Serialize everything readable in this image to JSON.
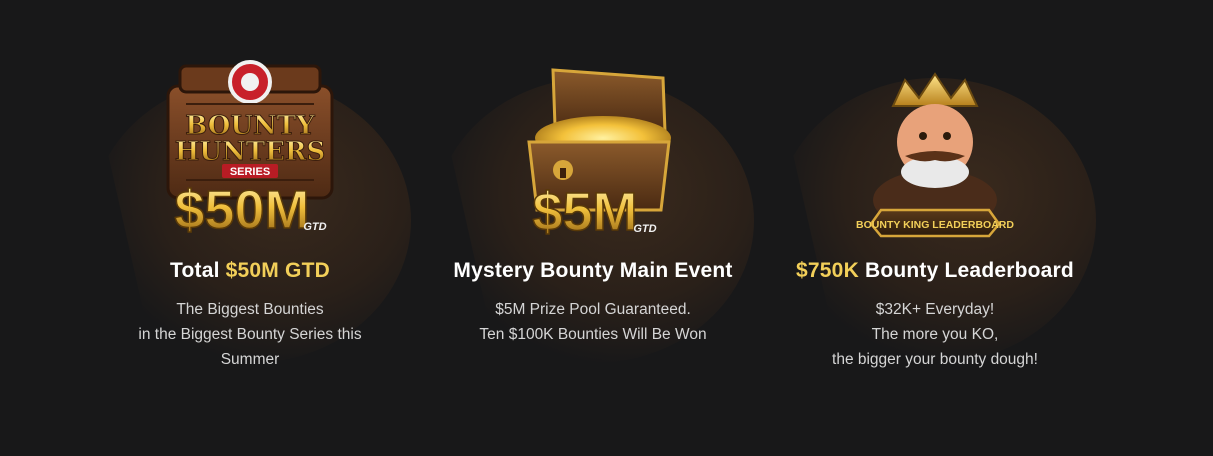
{
  "cards": [
    {
      "art": {
        "top_text": "BOUNTY",
        "mid_text": "HUNTERS",
        "ribbon": "SERIES",
        "amount": "$50M",
        "suffix": "GTD"
      },
      "title_plain": "Total ",
      "title_highlight": "$50M GTD",
      "lines": [
        "The Biggest Bounties",
        "in the Biggest Bounty Series this",
        "Summer"
      ]
    },
    {
      "art": {
        "amount": "$5M",
        "suffix": "GTD"
      },
      "title_plain": "Mystery Bounty Main Event",
      "lines": [
        "$5M Prize Pool Guaranteed.",
        "Ten $100K Bounties Will Be Won"
      ]
    },
    {
      "art": {
        "banner": "BOUNTY KING LEADERBOARD"
      },
      "title_highlight": "$750K",
      "title_plain": " Bounty Leaderboard",
      "lines": [
        "$32K+ Everyday!",
        "The more you KO,",
        "the bigger your bounty dough!"
      ]
    }
  ],
  "colors": {
    "background": "#181819",
    "highlight": "#f2cf59",
    "text": "#ffffff",
    "subtext": "#d5d5d5"
  }
}
